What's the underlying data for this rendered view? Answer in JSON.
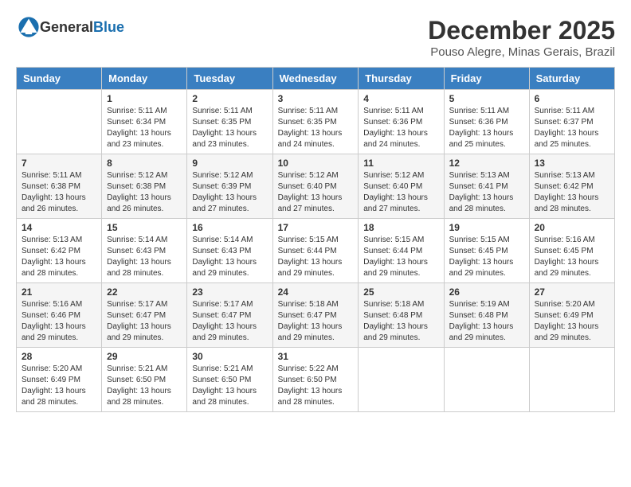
{
  "header": {
    "logo_general": "General",
    "logo_blue": "Blue",
    "month": "December 2025",
    "location": "Pouso Alegre, Minas Gerais, Brazil"
  },
  "weekdays": [
    "Sunday",
    "Monday",
    "Tuesday",
    "Wednesday",
    "Thursday",
    "Friday",
    "Saturday"
  ],
  "weeks": [
    [
      {
        "day": "",
        "info": ""
      },
      {
        "day": "1",
        "info": "Sunrise: 5:11 AM\nSunset: 6:34 PM\nDaylight: 13 hours\nand 23 minutes."
      },
      {
        "day": "2",
        "info": "Sunrise: 5:11 AM\nSunset: 6:35 PM\nDaylight: 13 hours\nand 23 minutes."
      },
      {
        "day": "3",
        "info": "Sunrise: 5:11 AM\nSunset: 6:35 PM\nDaylight: 13 hours\nand 24 minutes."
      },
      {
        "day": "4",
        "info": "Sunrise: 5:11 AM\nSunset: 6:36 PM\nDaylight: 13 hours\nand 24 minutes."
      },
      {
        "day": "5",
        "info": "Sunrise: 5:11 AM\nSunset: 6:36 PM\nDaylight: 13 hours\nand 25 minutes."
      },
      {
        "day": "6",
        "info": "Sunrise: 5:11 AM\nSunset: 6:37 PM\nDaylight: 13 hours\nand 25 minutes."
      }
    ],
    [
      {
        "day": "7",
        "info": "Sunrise: 5:11 AM\nSunset: 6:38 PM\nDaylight: 13 hours\nand 26 minutes."
      },
      {
        "day": "8",
        "info": "Sunrise: 5:12 AM\nSunset: 6:38 PM\nDaylight: 13 hours\nand 26 minutes."
      },
      {
        "day": "9",
        "info": "Sunrise: 5:12 AM\nSunset: 6:39 PM\nDaylight: 13 hours\nand 27 minutes."
      },
      {
        "day": "10",
        "info": "Sunrise: 5:12 AM\nSunset: 6:40 PM\nDaylight: 13 hours\nand 27 minutes."
      },
      {
        "day": "11",
        "info": "Sunrise: 5:12 AM\nSunset: 6:40 PM\nDaylight: 13 hours\nand 27 minutes."
      },
      {
        "day": "12",
        "info": "Sunrise: 5:13 AM\nSunset: 6:41 PM\nDaylight: 13 hours\nand 28 minutes."
      },
      {
        "day": "13",
        "info": "Sunrise: 5:13 AM\nSunset: 6:42 PM\nDaylight: 13 hours\nand 28 minutes."
      }
    ],
    [
      {
        "day": "14",
        "info": "Sunrise: 5:13 AM\nSunset: 6:42 PM\nDaylight: 13 hours\nand 28 minutes."
      },
      {
        "day": "15",
        "info": "Sunrise: 5:14 AM\nSunset: 6:43 PM\nDaylight: 13 hours\nand 28 minutes."
      },
      {
        "day": "16",
        "info": "Sunrise: 5:14 AM\nSunset: 6:43 PM\nDaylight: 13 hours\nand 29 minutes."
      },
      {
        "day": "17",
        "info": "Sunrise: 5:15 AM\nSunset: 6:44 PM\nDaylight: 13 hours\nand 29 minutes."
      },
      {
        "day": "18",
        "info": "Sunrise: 5:15 AM\nSunset: 6:44 PM\nDaylight: 13 hours\nand 29 minutes."
      },
      {
        "day": "19",
        "info": "Sunrise: 5:15 AM\nSunset: 6:45 PM\nDaylight: 13 hours\nand 29 minutes."
      },
      {
        "day": "20",
        "info": "Sunrise: 5:16 AM\nSunset: 6:45 PM\nDaylight: 13 hours\nand 29 minutes."
      }
    ],
    [
      {
        "day": "21",
        "info": "Sunrise: 5:16 AM\nSunset: 6:46 PM\nDaylight: 13 hours\nand 29 minutes."
      },
      {
        "day": "22",
        "info": "Sunrise: 5:17 AM\nSunset: 6:47 PM\nDaylight: 13 hours\nand 29 minutes."
      },
      {
        "day": "23",
        "info": "Sunrise: 5:17 AM\nSunset: 6:47 PM\nDaylight: 13 hours\nand 29 minutes."
      },
      {
        "day": "24",
        "info": "Sunrise: 5:18 AM\nSunset: 6:47 PM\nDaylight: 13 hours\nand 29 minutes."
      },
      {
        "day": "25",
        "info": "Sunrise: 5:18 AM\nSunset: 6:48 PM\nDaylight: 13 hours\nand 29 minutes."
      },
      {
        "day": "26",
        "info": "Sunrise: 5:19 AM\nSunset: 6:48 PM\nDaylight: 13 hours\nand 29 minutes."
      },
      {
        "day": "27",
        "info": "Sunrise: 5:20 AM\nSunset: 6:49 PM\nDaylight: 13 hours\nand 29 minutes."
      }
    ],
    [
      {
        "day": "28",
        "info": "Sunrise: 5:20 AM\nSunset: 6:49 PM\nDaylight: 13 hours\nand 28 minutes."
      },
      {
        "day": "29",
        "info": "Sunrise: 5:21 AM\nSunset: 6:50 PM\nDaylight: 13 hours\nand 28 minutes."
      },
      {
        "day": "30",
        "info": "Sunrise: 5:21 AM\nSunset: 6:50 PM\nDaylight: 13 hours\nand 28 minutes."
      },
      {
        "day": "31",
        "info": "Sunrise: 5:22 AM\nSunset: 6:50 PM\nDaylight: 13 hours\nand 28 minutes."
      },
      {
        "day": "",
        "info": ""
      },
      {
        "day": "",
        "info": ""
      },
      {
        "day": "",
        "info": ""
      }
    ]
  ]
}
